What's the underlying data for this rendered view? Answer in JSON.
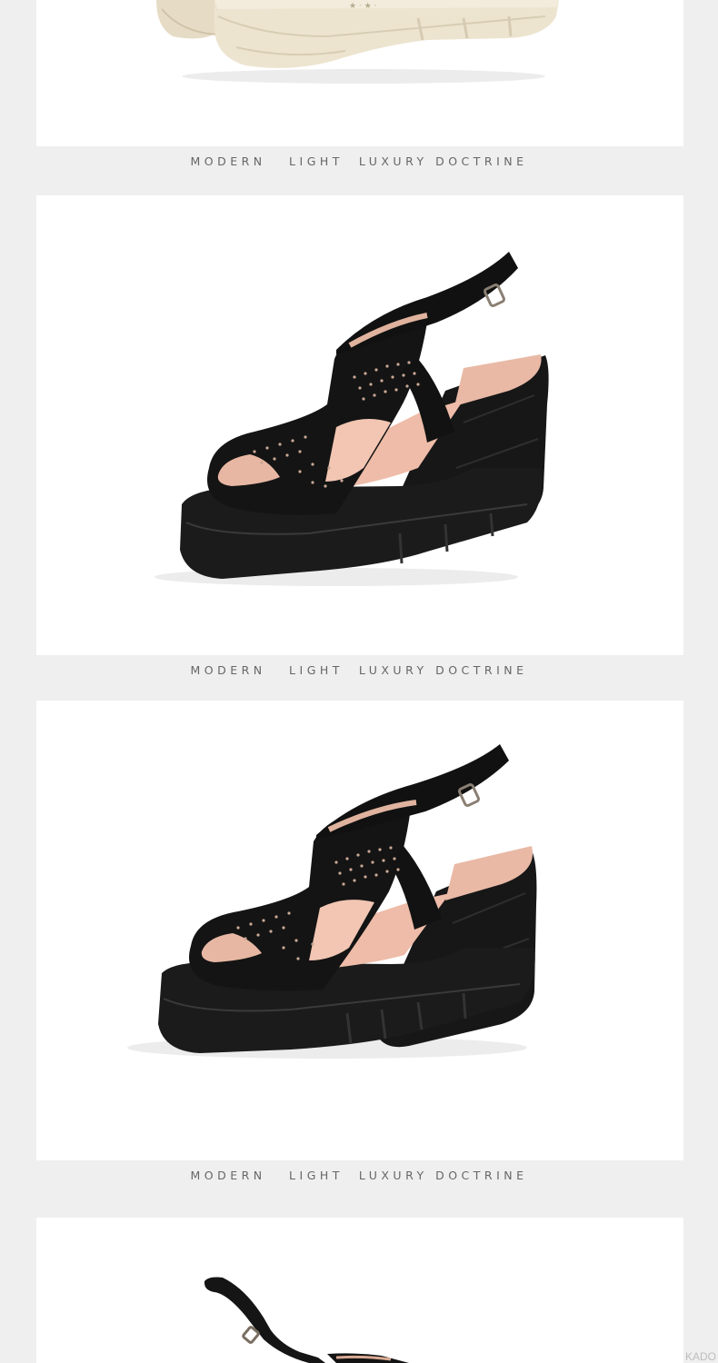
{
  "captions": [
    "MODERN   LIGHT  LUXURY DOCTRINE",
    "MODERN   LIGHT  LUXURY DOCTRINE",
    "MODERN   LIGHT  LUXURY DOCTRINE"
  ],
  "watermark": "KADO",
  "products": [
    {
      "image": "beige-wedge-sandal-image",
      "color": "#ede4d0"
    },
    {
      "image": "black-wedge-sandal-image",
      "color": "#1a1a1a"
    },
    {
      "image": "black-wedge-sandal-image",
      "color": "#1a1a1a"
    },
    {
      "image": "black-wedge-sandal-image",
      "color": "#1a1a1a"
    }
  ]
}
